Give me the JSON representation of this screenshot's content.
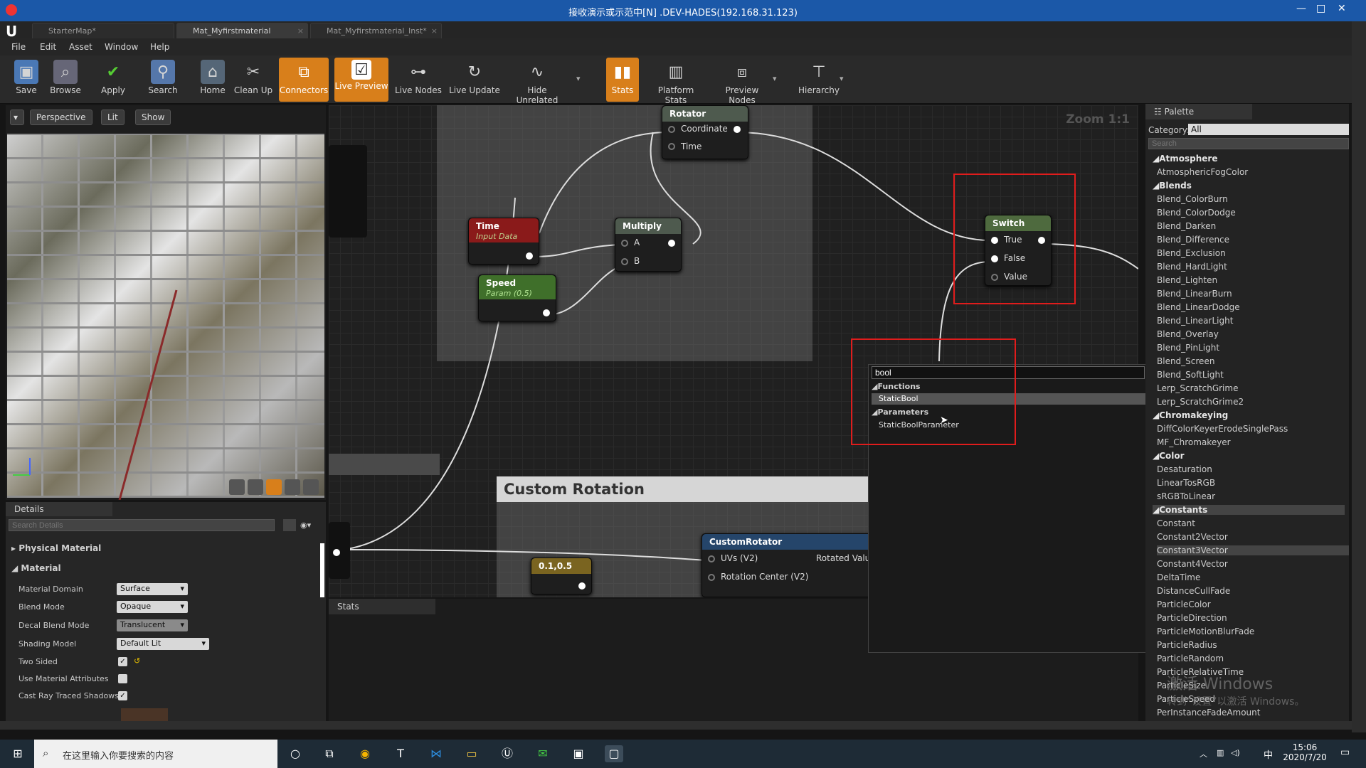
{
  "window_title": "接收演示或示范中[N] .DEV-HADES(192.168.31.123)",
  "tabs": [
    {
      "label": "StarterMap*"
    },
    {
      "label": "Mat_Myfirstmaterial"
    },
    {
      "label": "Mat_Myfirstmaterial_Inst*"
    }
  ],
  "menu": [
    "File",
    "Edit",
    "Asset",
    "Window",
    "Help"
  ],
  "toolbar": [
    {
      "label": "Save",
      "icon": "save-icon",
      "active": false
    },
    {
      "label": "Browse",
      "icon": "browse-icon",
      "active": false
    },
    {
      "label": "Apply",
      "icon": "apply-icon",
      "active": false
    },
    {
      "label": "Search",
      "icon": "search-icon",
      "active": false
    },
    {
      "label": "Home",
      "icon": "home-icon",
      "active": false
    },
    {
      "label": "Clean Up",
      "icon": "cleanup-icon",
      "active": false
    },
    {
      "label": "Connectors",
      "icon": "connectors-icon",
      "active": true
    },
    {
      "label": "Live Preview",
      "icon": "live-preview-icon",
      "active": true
    },
    {
      "label": "Live Nodes",
      "icon": "live-nodes-icon",
      "active": false
    },
    {
      "label": "Live Update",
      "icon": "live-update-icon",
      "active": false
    },
    {
      "label": "Hide Unrelated",
      "icon": "hide-unrelated-icon",
      "active": false
    },
    {
      "label": "Stats",
      "icon": "stats-icon",
      "active": true
    },
    {
      "label": "Platform Stats",
      "icon": "platform-stats-icon",
      "active": false
    },
    {
      "label": "Preview Nodes",
      "icon": "preview-nodes-icon",
      "active": false
    },
    {
      "label": "Hierarchy",
      "icon": "hierarchy-icon",
      "active": false
    }
  ],
  "viewport": {
    "perspective": "Perspective",
    "lit": "Lit",
    "show": "Show"
  },
  "details": {
    "tab": "Details",
    "search_placeholder": "Search Details",
    "sections": [
      "Physical Material",
      "Material"
    ],
    "props": [
      {
        "label": "Material Domain",
        "value": "Surface"
      },
      {
        "label": "Blend Mode",
        "value": "Opaque"
      },
      {
        "label": "Decal Blend Mode",
        "value": "Translucent"
      },
      {
        "label": "Shading Model",
        "value": "Default Lit"
      },
      {
        "label": "Two Sided",
        "value": "✓"
      },
      {
        "label": "Use Material Attributes",
        "value": ""
      },
      {
        "label": "Cast Ray Traced Shadows",
        "value": "✓"
      }
    ]
  },
  "graph": {
    "zoom": "Zoom 1:1",
    "comment": "Custom Rotation",
    "nodes": {
      "rotator": {
        "title": "Rotator",
        "pins": [
          "Coordinate",
          "Time"
        ]
      },
      "time": {
        "title": "Time",
        "sub": "Input Data"
      },
      "multiply": {
        "title": "Multiply",
        "pins": [
          "A",
          "B"
        ]
      },
      "speed": {
        "title": "Speed",
        "sub": "Param (0.5)"
      },
      "switch": {
        "title": "Switch",
        "pins": [
          "True",
          "False",
          "Value"
        ]
      },
      "custom_rotator": {
        "title": "CustomRotator",
        "pins": [
          "UVs (V2)",
          "Rotation Center (V2)"
        ],
        "out": "Rotated Value"
      },
      "const": {
        "title": "0.1,0.5"
      }
    }
  },
  "context_menu": {
    "search_value": "bool",
    "groups": [
      {
        "name": "Functions",
        "items": [
          "StaticBool"
        ]
      },
      {
        "name": "Parameters",
        "items": [
          "StaticBoolParameter"
        ]
      }
    ]
  },
  "stats": {
    "tab": "Stats"
  },
  "palette": {
    "tab": "Palette",
    "category_label": "Category:",
    "category_value": "All",
    "search_placeholder": "Search",
    "entries": [
      {
        "t": "Atmosphere",
        "cat": true
      },
      {
        "t": "AtmosphericFogColor"
      },
      {
        "t": "Blends",
        "cat": true
      },
      {
        "t": "Blend_ColorBurn"
      },
      {
        "t": "Blend_ColorDodge"
      },
      {
        "t": "Blend_Darken"
      },
      {
        "t": "Blend_Difference"
      },
      {
        "t": "Blend_Exclusion"
      },
      {
        "t": "Blend_HardLight"
      },
      {
        "t": "Blend_Lighten"
      },
      {
        "t": "Blend_LinearBurn"
      },
      {
        "t": "Blend_LinearDodge"
      },
      {
        "t": "Blend_LinearLight"
      },
      {
        "t": "Blend_Overlay"
      },
      {
        "t": "Blend_PinLight"
      },
      {
        "t": "Blend_Screen"
      },
      {
        "t": "Blend_SoftLight"
      },
      {
        "t": "Lerp_ScratchGrime"
      },
      {
        "t": "Lerp_ScratchGrime2"
      },
      {
        "t": "Chromakeying",
        "cat": true
      },
      {
        "t": "DiffColorKeyerErodeSinglePass"
      },
      {
        "t": "MF_Chromakeyer"
      },
      {
        "t": "Color",
        "cat": true
      },
      {
        "t": "Desaturation"
      },
      {
        "t": "LinearTosRGB"
      },
      {
        "t": "sRGBToLinear"
      },
      {
        "t": "Constants",
        "cat": true
      },
      {
        "t": "Constant"
      },
      {
        "t": "Constant2Vector"
      },
      {
        "t": "Constant3Vector"
      },
      {
        "t": "Constant4Vector"
      },
      {
        "t": "DeltaTime"
      },
      {
        "t": "DistanceCullFade"
      },
      {
        "t": "ParticleColor"
      },
      {
        "t": "ParticleDirection"
      },
      {
        "t": "ParticleMotionBlurFade"
      },
      {
        "t": "ParticleRadius"
      },
      {
        "t": "ParticleRandom"
      },
      {
        "t": "ParticleRelativeTime"
      },
      {
        "t": "ParticleSize"
      },
      {
        "t": "ParticleSpeed"
      },
      {
        "t": "PerInstanceFadeAmount"
      }
    ]
  },
  "watermark": {
    "line1": "激活 Windows",
    "line2": "转到“设置”以激活 Windows。"
  },
  "taskbar": {
    "search_placeholder": "在这里输入你要搜索的内容",
    "time": "15:06",
    "date": "2020/7/20",
    "ime": "中"
  }
}
